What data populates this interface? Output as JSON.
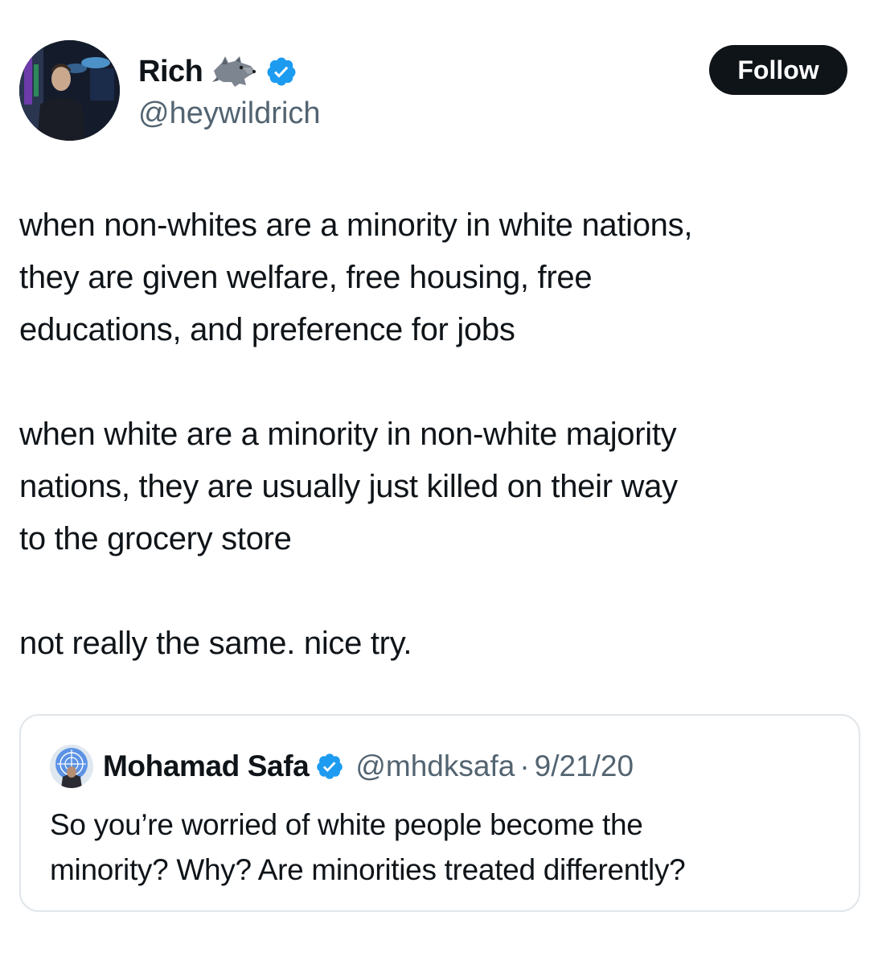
{
  "tweet": {
    "author": {
      "display_name": "Rich",
      "handle": "@heywildrich",
      "emoji_icon": "wolf-icon",
      "verified_icon": "verified-badge-icon",
      "verified_color": "#1d9bf0"
    },
    "follow_label": "Follow",
    "paragraphs": [
      "when non-whites are a minority in white nations,\nthey are given welfare, free housing, free\neducations, and preference for jobs",
      "when white are a minority in non-white majority\nnations, they are usually just killed on their way\nto the grocery store",
      "not really the same. nice try."
    ]
  },
  "quote": {
    "display_name": "Mohamad Safa",
    "handle": "@mhdksafa",
    "separator": "·",
    "date": "9/21/20",
    "text": "So you’re worried of white people become the\nminority? Why? Are minorities treated differently?"
  },
  "colors": {
    "text": "#0f1419",
    "secondary": "#536471",
    "follow_bg": "#0f1419",
    "card_border": "#e1e6ea"
  }
}
